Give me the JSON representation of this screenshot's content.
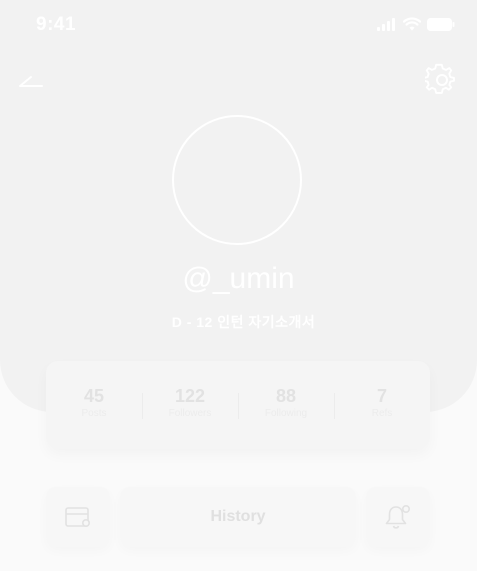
{
  "status_bar": {
    "time": "9:41",
    "icons": [
      "cellular-signal-icon",
      "wifi-icon",
      "battery-icon"
    ]
  },
  "header": {
    "back_icon": "back-arrow-icon",
    "settings_icon": "gear-icon"
  },
  "profile": {
    "username": "@_umin",
    "bio": "D - 12 인턴 자기소개서"
  },
  "stats": [
    {
      "value": "45",
      "label": "Posts"
    },
    {
      "value": "122",
      "label": "Followers"
    },
    {
      "value": "88",
      "label": "Following"
    },
    {
      "value": "7",
      "label": "Refs"
    }
  ],
  "actions": {
    "wallet_icon": "wallet-icon",
    "history_label": "History",
    "bell_icon": "bell-icon"
  },
  "colors": {
    "hero_bg": "#f2f2f2",
    "page_bg": "#fafafa",
    "hero_text": "#ffffff",
    "faint_text": "#e2e2e2"
  }
}
